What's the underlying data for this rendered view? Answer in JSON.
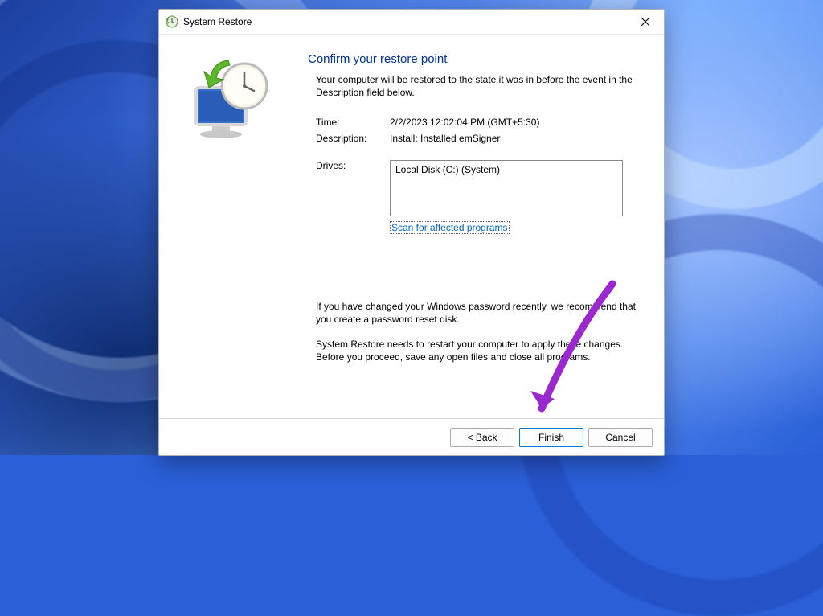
{
  "window": {
    "title": "System Restore"
  },
  "content": {
    "heading": "Confirm your restore point",
    "intro": "Your computer will be restored to the state it was in before the event in the Description field below.",
    "timeLabel": "Time:",
    "timeValue": "2/2/2023 12:02:04 PM (GMT+5:30)",
    "descLabel": "Description:",
    "descValue": "Install: Installed emSigner",
    "drivesLabel": "Drives:",
    "drivesValue": "Local Disk (C:) (System)",
    "scanLink": "Scan for affected programs",
    "note1": "If you have changed your Windows password recently, we recommend that you create a password reset disk.",
    "note2": "System Restore needs to restart your computer to apply these changes. Before you proceed, save any open files and close all programs."
  },
  "buttons": {
    "back": "< Back",
    "finish": "Finish",
    "cancel": "Cancel"
  },
  "annotation": {
    "arrowColor": "#9b27cf"
  }
}
